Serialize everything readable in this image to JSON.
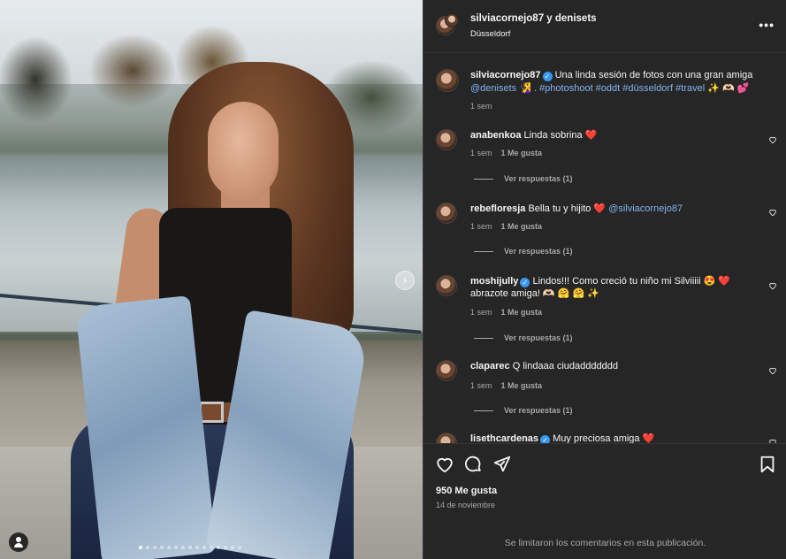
{
  "photo": {
    "carousel_dots": 15,
    "active_dot": 0,
    "next_icon": "chevron-right-icon",
    "tag_icon": "user-tag-icon"
  },
  "header": {
    "title": "silviacornejo87 y denisets",
    "location": "Düsseldorf",
    "more_icon": "more-horizontal-icon",
    "more_label": "•••"
  },
  "caption": {
    "user": "silviacornejo87",
    "verified": true,
    "text": "Una linda sesión de fotos con una gran amiga",
    "line2_mention": "@denisets",
    "line2_rest": "🧏‍♀️ . #photoshoot #oddt #düsseldorf #travel ✨ 🫶🏻 💕",
    "time": "1 sem"
  },
  "comments": [
    {
      "user": "anabenkoa",
      "verified": false,
      "text": "Linda sobrina ❤️",
      "text2": "",
      "time": "1 sem",
      "likes": "1 Me gusta",
      "replies": "Ver respuestas (1)"
    },
    {
      "user": "rebefloresja",
      "verified": false,
      "text": "Bella tu y hijito ❤️",
      "mention": "@silviacornejo87",
      "text2": "",
      "time": "1 sem",
      "likes": "1 Me gusta",
      "replies": "Ver respuestas (1)"
    },
    {
      "user": "moshijully",
      "verified": true,
      "text": "Lindos!!! Como creció tu niño mi Silviiiii 😍 ❤️",
      "text2": "abrazote amiga! 🫶🏻 🤗 🤗 ✨",
      "time": "1 sem",
      "likes": "1 Me gusta",
      "replies": "Ver respuestas (1)"
    },
    {
      "user": "claparec",
      "verified": false,
      "text": "Q lindaaa ciudaddddddd",
      "text2": "",
      "time": "1 sem",
      "likes": "1 Me gusta",
      "replies": "Ver respuestas (1)"
    },
    {
      "user": "lisethcardenas",
      "verified": true,
      "text": "Muy preciosa amiga ❤️",
      "text2": "",
      "time": "",
      "likes": "",
      "replies": ""
    }
  ],
  "actions": {
    "like_icon": "heart-icon",
    "comment_icon": "comment-icon",
    "share_icon": "send-icon",
    "save_icon": "bookmark-icon",
    "likes": "950 Me gusta",
    "date": "14 de noviembre",
    "limited_notice": "Se limitaron los comentarios en esta publicación."
  },
  "colors": {
    "panel_bg": "#262626",
    "link": "#82b4f0",
    "verified": "#3897f0",
    "heart": "#ed4956",
    "muted": "#a8a8a8"
  }
}
